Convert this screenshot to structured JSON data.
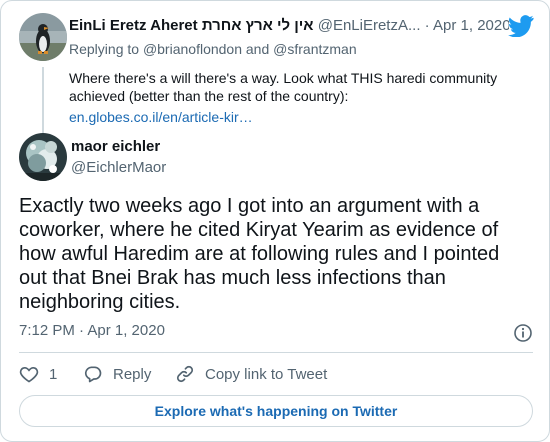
{
  "parent": {
    "name": "EinLi Eretz Aheret אין לי ארץ אחרת",
    "handle": "@EnLiEretzA...",
    "dot": "·",
    "date": "Apr 1, 2020",
    "replying_prefix": "Replying to",
    "replying_user1": "@brianoflondon",
    "replying_and": "and",
    "replying_user2": "@sfrantzman",
    "text": "Where there's a will there's a way. Look what THIS haredi community achieved (better than the rest of the country):",
    "link": "en.globes.co.il/en/article-kir…"
  },
  "author": {
    "name": "maor eichler",
    "handle": "@EichlerMaor"
  },
  "tweet": {
    "text": "Exactly two weeks ago I got into an argument with a coworker, where he cited Kiryat Yearim as evidence of how awful Haredim are at following rules and I pointed out that Bnei Brak has much less infections than neighboring cities.",
    "time": "7:12 PM · Apr 1, 2020"
  },
  "actions": {
    "like_count": "1",
    "reply_label": "Reply",
    "copy_label": "Copy link to Tweet"
  },
  "explore_label": "Explore what's happening on Twitter",
  "colors": {
    "link": "#1b6ab3",
    "twitter_blue": "#1d9bf0",
    "muted": "#536471",
    "border": "#cfd9de"
  }
}
